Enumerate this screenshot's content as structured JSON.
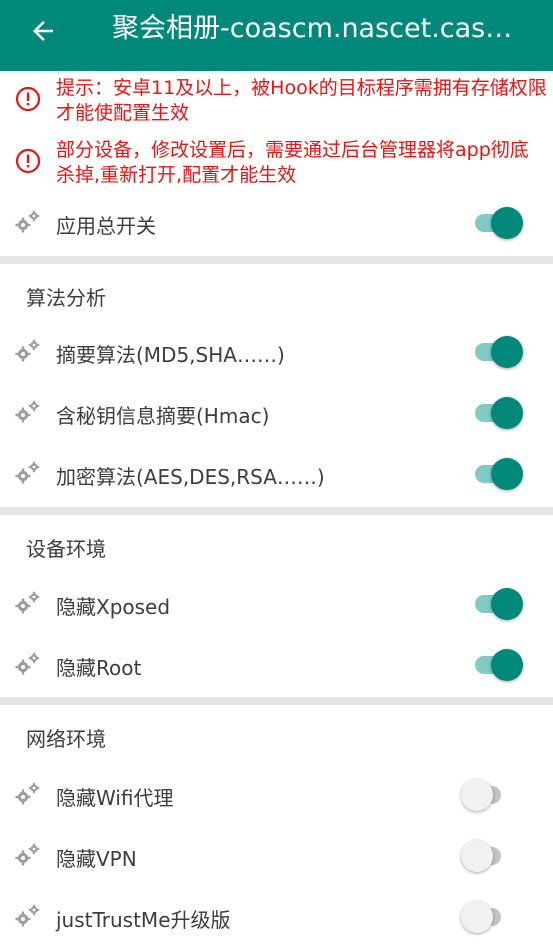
{
  "appbar": {
    "title": "聚会相册-coascm.nascet.cas…",
    "background": "#00897b"
  },
  "notices": [
    {
      "text": "提示：安卓11及以上，被Hook的目标程序需拥有存储权限才能使配置生效"
    },
    {
      "text": "部分设备，修改设置后，需要通过后台管理器将app彻底杀掉,重新打开,配置才能生效"
    }
  ],
  "colors": {
    "accent": "#00897b",
    "warning": "#e81515"
  },
  "general": {
    "items": [
      {
        "label": "应用总开关",
        "enabled": true
      }
    ]
  },
  "sections": [
    {
      "title": "算法分析",
      "items": [
        {
          "label": "摘要算法(MD5,SHA……)",
          "enabled": true
        },
        {
          "label": "含秘钥信息摘要(Hmac)",
          "enabled": true
        },
        {
          "label": "加密算法(AES,DES,RSA……)",
          "enabled": true
        }
      ]
    },
    {
      "title": "设备环境",
      "items": [
        {
          "label": "隐藏Xposed",
          "enabled": true
        },
        {
          "label": "隐藏Root",
          "enabled": true
        }
      ]
    },
    {
      "title": "网络环境",
      "items": [
        {
          "label": "隐藏Wifi代理",
          "enabled": false
        },
        {
          "label": "隐藏VPN",
          "enabled": false
        },
        {
          "label": "justTrustMe升级版",
          "enabled": false
        }
      ]
    }
  ]
}
